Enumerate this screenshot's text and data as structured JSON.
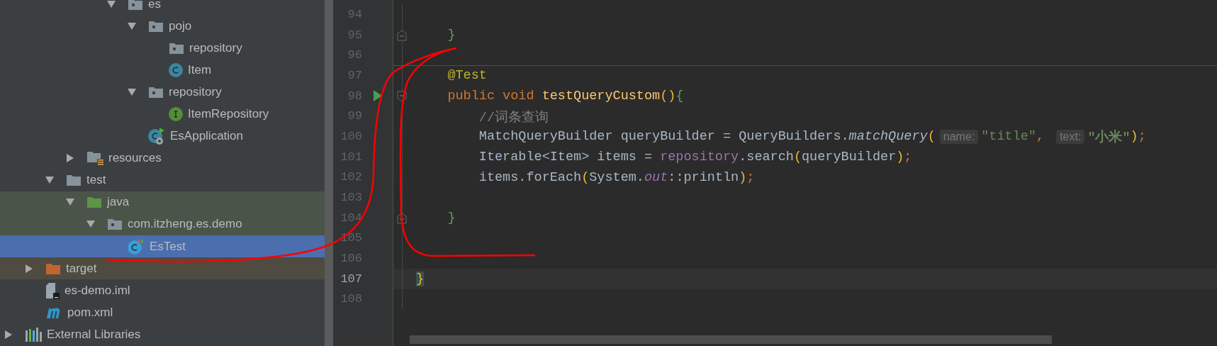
{
  "project_tree": [
    {
      "children": [
        {
          "children": [
            {
              "children": [
                {
                  "children": [
                    {
                      "children": [
                        {
                          "label": "es",
                          "kind": "package",
                          "expanded": true,
                          "selected": false,
                          "children": [
                            {
                              "label": "pojo",
                              "kind": "package",
                              "expanded": true,
                              "selected": false,
                              "children": [
                                {
                                  "label": "repository",
                                  "kind": "package",
                                  "selected": false
                                },
                                {
                                  "label": "Item",
                                  "kind": "class",
                                  "selected": false
                                }
                              ]
                            },
                            {
                              "label": "repository",
                              "kind": "package",
                              "expanded": true,
                              "selected": false,
                              "children": [
                                {
                                  "label": "ItemRepository",
                                  "kind": "interface",
                                  "selected": false
                                }
                              ]
                            },
                            {
                              "label": "EsApplication",
                              "kind": "app-class",
                              "selected": false
                            }
                          ]
                        }
                      ]
                    }
                  ]
                },
                {
                  "label": "resources",
                  "kind": "resources",
                  "expanded": false,
                  "selected": false
                }
              ]
            },
            {
              "label": "test",
              "kind": "folder",
              "expanded": true,
              "selected": false,
              "children": [
                {
                  "label": "java",
                  "kind": "test-root",
                  "test_scope": true,
                  "expanded": true,
                  "selected": false,
                  "children": [
                    {
                      "label": "com.itzheng.es.demo",
                      "kind": "package",
                      "test_scope": true,
                      "expanded": true,
                      "selected": false,
                      "children": [
                        {
                          "label": "EsTest",
                          "kind": "test-class",
                          "selected": true
                        }
                      ]
                    }
                  ]
                }
              ]
            }
          ]
        },
        {
          "label": "target",
          "kind": "excluded",
          "excluded": true,
          "expanded": false,
          "selected": false
        },
        {
          "label": "es-demo.iml",
          "kind": "iml",
          "selected": false
        },
        {
          "label": "pom.xml",
          "kind": "maven",
          "selected": false
        }
      ]
    },
    {
      "label": "External Libraries",
      "kind": "libraries",
      "expanded": false,
      "selected": false
    }
  ],
  "editor": {
    "lines": [
      {
        "number": "94",
        "current": false
      },
      {
        "number": "95",
        "current": false,
        "fold_end": true,
        "tokens": [
          {
            "text": "    }",
            "kind": "brace"
          }
        ]
      },
      {
        "number": "96",
        "current": false
      },
      {
        "number": "97",
        "current": false,
        "separator": true,
        "tokens": [
          {
            "text": "    @Test",
            "kind": "annotation"
          }
        ]
      },
      {
        "number": "98",
        "current": false,
        "run": true,
        "fold_start": true,
        "tokens": [
          {
            "text": "    public void ",
            "kind": "keyword"
          },
          {
            "text": "testQueryCustom",
            "kind": "method"
          },
          {
            "text": "()",
            "kind": "paren"
          },
          {
            "text": "{",
            "kind": "brace"
          }
        ]
      },
      {
        "number": "99",
        "current": false,
        "tokens": [
          {
            "text": "        //词条查询",
            "kind": "comment"
          }
        ]
      },
      {
        "number": "100",
        "current": false,
        "tokens": [
          {
            "text": "        MatchQueryBuilder queryBuilder = QueryBuilders.",
            "kind": "plain"
          },
          {
            "text": "matchQuery",
            "kind": "static"
          },
          {
            "text": "(",
            "kind": "paren"
          },
          {
            "text": "name:",
            "kind": "hint"
          },
          {
            "text": "\"title\"",
            "kind": "string"
          },
          {
            "text": ", ",
            "kind": "punct"
          },
          {
            "text": "text:",
            "kind": "hint"
          },
          {
            "text": "\"小米\"",
            "kind": "string-bold"
          },
          {
            "text": ")",
            "kind": "paren"
          },
          {
            "text": ";",
            "kind": "punct"
          }
        ]
      },
      {
        "number": "101",
        "current": false,
        "tokens": [
          {
            "text": "        Iterable<Item> items = ",
            "kind": "plain"
          },
          {
            "text": "repository",
            "kind": "field"
          },
          {
            "text": ".search",
            "kind": "plain"
          },
          {
            "text": "(",
            "kind": "paren"
          },
          {
            "text": "queryBuilder",
            "kind": "plain"
          },
          {
            "text": ")",
            "kind": "paren"
          },
          {
            "text": ";",
            "kind": "punct"
          }
        ]
      },
      {
        "number": "102",
        "current": false,
        "tokens": [
          {
            "text": "        items.forEach",
            "kind": "plain"
          },
          {
            "text": "(",
            "kind": "paren"
          },
          {
            "text": "System.",
            "kind": "plain"
          },
          {
            "text": "out",
            "kind": "static-field"
          },
          {
            "text": "::println",
            "kind": "plain"
          },
          {
            "text": ")",
            "kind": "paren"
          },
          {
            "text": ";",
            "kind": "punct"
          }
        ]
      },
      {
        "number": "103",
        "current": false
      },
      {
        "number": "104",
        "current": false,
        "fold_end": true,
        "tokens": [
          {
            "text": "    }",
            "kind": "brace"
          }
        ]
      },
      {
        "number": "105",
        "current": false
      },
      {
        "number": "106",
        "current": false
      },
      {
        "number": "107",
        "current": true,
        "tokens": [
          {
            "text": "}",
            "kind": "brace-match"
          }
        ]
      },
      {
        "number": "108",
        "current": false
      }
    ]
  }
}
